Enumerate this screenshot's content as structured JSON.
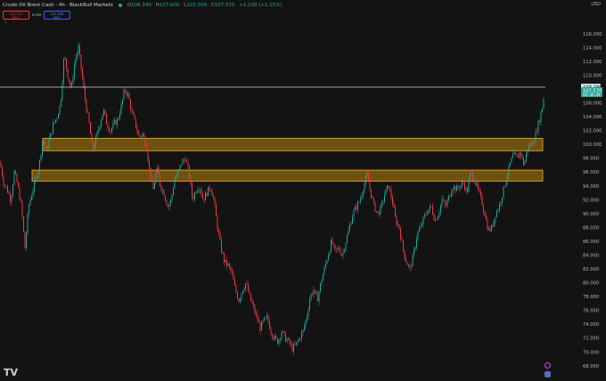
{
  "header": {
    "title": "Crude Oil Brent Cash · 4h · BlackBull Markets",
    "ohlc": [
      {
        "k": "O",
        "v": "106.340"
      },
      {
        "k": "H",
        "v": "107.600"
      },
      {
        "k": "L",
        "v": "105.508"
      },
      {
        "k": "C",
        "v": "107.570"
      }
    ],
    "change": "+1.230 (+1.15%)"
  },
  "trade": {
    "sell_price": "107.570",
    "sell_label": "SELL",
    "spread": "0.039",
    "buy_price": "107.598",
    "buy_label": "BUY"
  },
  "currency": "USD",
  "logo": "TV",
  "colors": {
    "background": "#131313",
    "up": "#26a69a",
    "down": "#f23645",
    "zone_fill": "#b8860b",
    "zone_stroke": "#ffa726",
    "price_label": "#26a69a",
    "hline": "#ffffff"
  },
  "chart_data": {
    "type": "candlestick",
    "title": "Crude Oil Brent Cash · 4h · BlackBull Markets",
    "xlabel": "",
    "ylabel": "",
    "ylim": [
      67,
      118
    ],
    "yticks": [
      68,
      70,
      72,
      74,
      76,
      78,
      80,
      82,
      84,
      86,
      88,
      90,
      92,
      94,
      96,
      98,
      100,
      102,
      104,
      106,
      108,
      110,
      112,
      114,
      116
    ],
    "grid": false,
    "last_price": 107.57,
    "last_price_label": "107.570",
    "countdown": "02:30:39",
    "horizontal_line": {
      "price": 108.286,
      "label": "108.286"
    },
    "zones": [
      {
        "low": 99.1,
        "high": 100.9
      },
      {
        "low": 94.7,
        "high": 96.3
      }
    ],
    "path": [
      [
        0,
        97.5
      ],
      [
        4,
        94.5
      ],
      [
        8,
        93.5
      ],
      [
        12,
        92
      ],
      [
        16,
        96
      ],
      [
        20,
        94
      ],
      [
        24,
        91
      ],
      [
        28,
        85
      ],
      [
        32,
        91
      ],
      [
        36,
        93
      ],
      [
        40,
        95
      ],
      [
        44,
        97
      ],
      [
        48,
        101
      ],
      [
        52,
        99
      ],
      [
        56,
        101
      ],
      [
        60,
        103
      ],
      [
        64,
        104
      ],
      [
        68,
        106
      ],
      [
        72,
        113
      ],
      [
        76,
        110
      ],
      [
        80,
        108
      ],
      [
        84,
        112
      ],
      [
        88,
        114
      ],
      [
        92,
        110
      ],
      [
        96,
        106
      ],
      [
        100,
        103
      ],
      [
        104,
        99
      ],
      [
        108,
        101
      ],
      [
        112,
        103
      ],
      [
        116,
        105
      ],
      [
        120,
        103
      ],
      [
        124,
        102
      ],
      [
        128,
        103
      ],
      [
        132,
        103.5
      ],
      [
        136,
        105.5
      ],
      [
        140,
        108
      ],
      [
        144,
        107
      ],
      [
        148,
        104.5
      ],
      [
        152,
        103
      ],
      [
        156,
        101
      ],
      [
        160,
        101.5
      ],
      [
        164,
        100
      ],
      [
        168,
        96
      ],
      [
        172,
        93.5
      ],
      [
        176,
        96.5
      ],
      [
        180,
        94
      ],
      [
        184,
        93
      ],
      [
        188,
        91
      ],
      [
        192,
        92
      ],
      [
        196,
        95
      ],
      [
        200,
        96
      ],
      [
        204,
        97.5
      ],
      [
        208,
        98
      ],
      [
        212,
        96
      ],
      [
        216,
        92
      ],
      [
        220,
        93.5
      ],
      [
        224,
        94
      ],
      [
        228,
        92
      ],
      [
        232,
        93
      ],
      [
        236,
        94
      ],
      [
        240,
        92
      ],
      [
        244,
        88
      ],
      [
        248,
        85
      ],
      [
        252,
        83
      ],
      [
        256,
        82.5
      ],
      [
        260,
        81.5
      ],
      [
        264,
        79
      ],
      [
        268,
        77.5
      ],
      [
        272,
        79
      ],
      [
        276,
        80
      ],
      [
        280,
        78
      ],
      [
        284,
        76.5
      ],
      [
        288,
        75
      ],
      [
        292,
        73.5
      ],
      [
        296,
        74.5
      ],
      [
        300,
        75
      ],
      [
        304,
        73
      ],
      [
        308,
        72
      ],
      [
        312,
        71.5
      ],
      [
        316,
        73
      ],
      [
        320,
        72
      ],
      [
        324,
        71.5
      ],
      [
        328,
        70.5
      ],
      [
        332,
        71
      ],
      [
        336,
        72
      ],
      [
        340,
        73
      ],
      [
        344,
        75
      ],
      [
        348,
        78
      ],
      [
        352,
        79
      ],
      [
        356,
        77.5
      ],
      [
        360,
        80
      ],
      [
        364,
        82
      ],
      [
        368,
        84
      ],
      [
        372,
        86
      ],
      [
        376,
        84.5
      ],
      [
        380,
        85
      ],
      [
        384,
        84
      ],
      [
        388,
        86
      ],
      [
        392,
        88
      ],
      [
        396,
        90
      ],
      [
        400,
        91
      ],
      [
        404,
        92
      ],
      [
        408,
        94
      ],
      [
        412,
        95.5
      ],
      [
        416,
        93
      ],
      [
        420,
        91
      ],
      [
        424,
        90
      ],
      [
        428,
        91
      ],
      [
        432,
        93
      ],
      [
        436,
        94
      ],
      [
        440,
        92
      ],
      [
        444,
        89
      ],
      [
        448,
        88
      ],
      [
        452,
        85
      ],
      [
        456,
        83
      ],
      [
        460,
        82
      ],
      [
        464,
        84
      ],
      [
        468,
        87
      ],
      [
        472,
        88
      ],
      [
        476,
        89.5
      ],
      [
        480,
        90.5
      ],
      [
        484,
        91
      ],
      [
        488,
        89
      ],
      [
        492,
        90
      ],
      [
        496,
        92
      ],
      [
        500,
        91
      ],
      [
        504,
        92.5
      ],
      [
        508,
        94
      ],
      [
        512,
        93.5
      ],
      [
        516,
        94
      ],
      [
        520,
        94.5
      ],
      [
        524,
        93
      ],
      [
        528,
        96
      ],
      [
        532,
        95
      ],
      [
        536,
        93.5
      ],
      [
        540,
        92
      ],
      [
        544,
        90
      ],
      [
        548,
        87.5
      ],
      [
        552,
        88
      ],
      [
        556,
        90
      ],
      [
        560,
        91
      ],
      [
        564,
        93
      ],
      [
        568,
        95
      ],
      [
        572,
        97
      ],
      [
        576,
        98.5
      ],
      [
        580,
        98
      ],
      [
        584,
        99
      ],
      [
        588,
        97
      ],
      [
        592,
        99.5
      ],
      [
        596,
        100
      ],
      [
        600,
        101
      ],
      [
        604,
        103
      ],
      [
        608,
        105
      ],
      [
        611,
        107.57
      ]
    ]
  }
}
